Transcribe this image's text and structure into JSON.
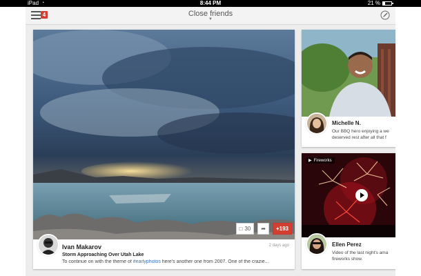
{
  "status_bar": {
    "device": "iPad",
    "time": "8:44 PM",
    "battery_text": "21 %",
    "battery_level": 0.21
  },
  "top_bar": {
    "notification_count": "4",
    "stream_title": "Close friends",
    "icons": [
      "menu-icon",
      "compose-icon"
    ]
  },
  "main_post": {
    "author": "Ivan Makarov",
    "time_ago": "2 days ago",
    "title": "Storm Approaching Over Utah Lake",
    "text_before": "To continue on with the theme of ",
    "hashtag": "#earlyphotos",
    "text_after": " here's another one from 2007. One of the crazie...",
    "comments_count": "30",
    "plus_count": "+193"
  },
  "side_posts": [
    {
      "author": "Michelle N.",
      "text_line1": "Our BBQ hero enjoying a we",
      "text_line2": "deserved rest after all that f"
    },
    {
      "tag": "Fireworks",
      "author": "Ellen Perez",
      "text_line1": "Video of the last night's ama",
      "text_line2": "fireworks show."
    }
  ],
  "colors": {
    "accent_red": "#d23f31",
    "hashtag_blue": "#3a72b5",
    "background": "#ededed"
  }
}
